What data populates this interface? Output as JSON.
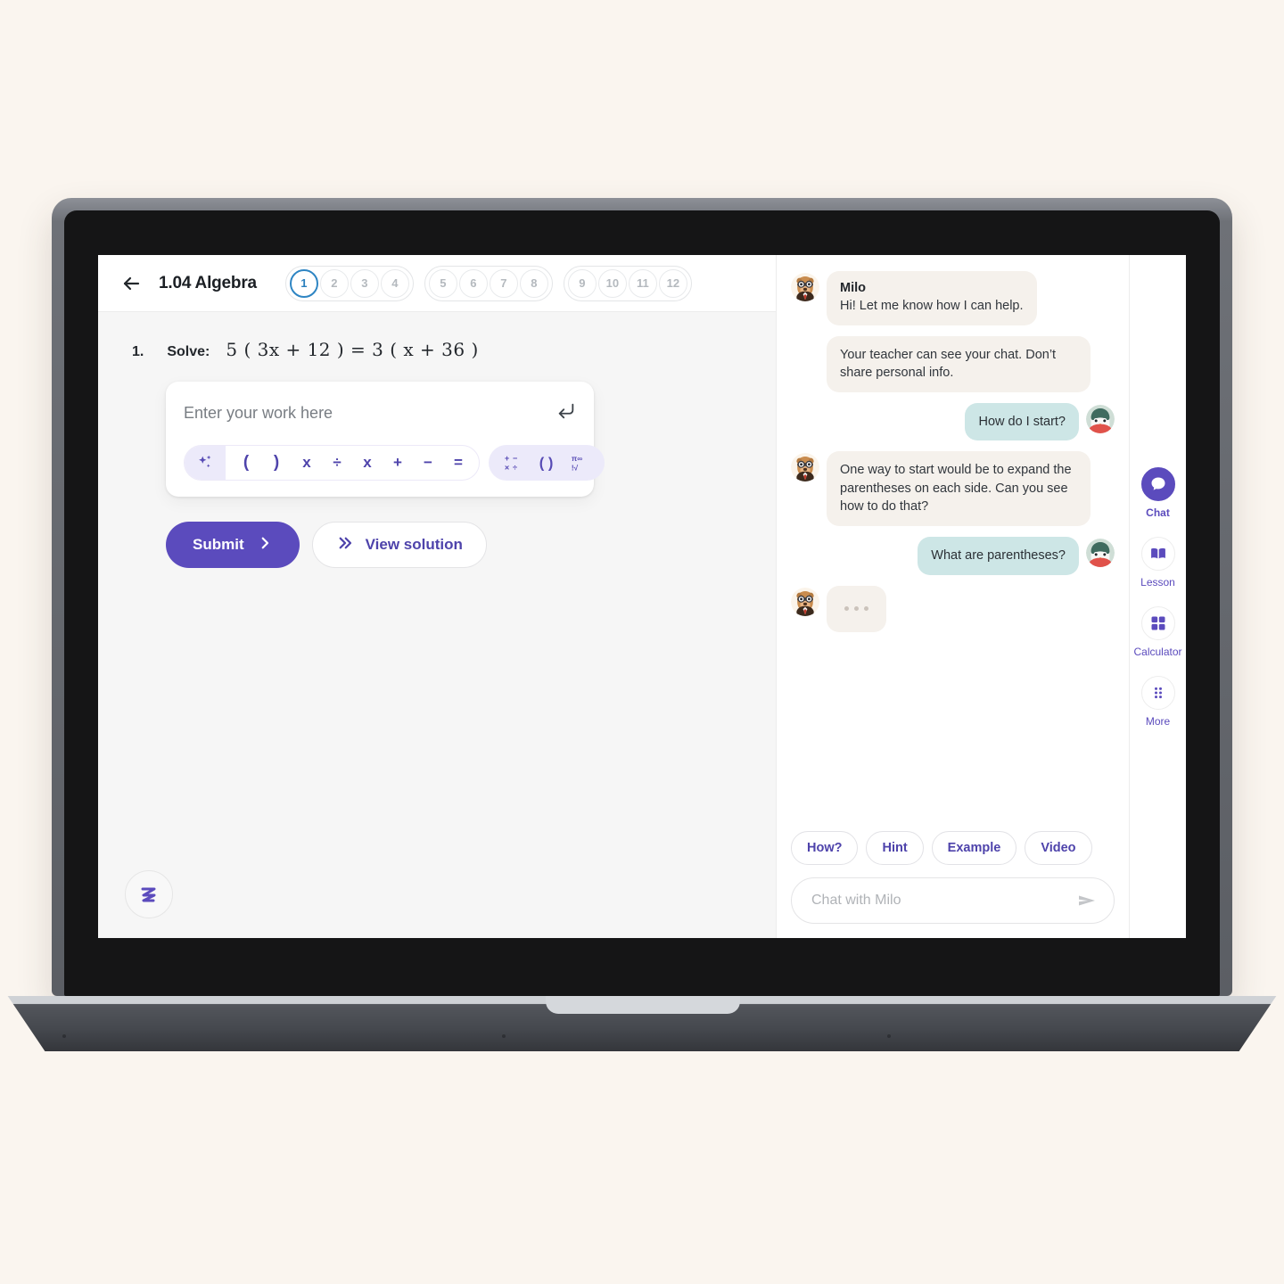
{
  "work": {
    "back_icon": "arrow-left-icon",
    "lesson_title": "1.04 Algebra",
    "pager_groups": [
      [
        "1",
        "2",
        "3",
        "4"
      ],
      [
        "5",
        "6",
        "7",
        "8"
      ],
      [
        "9",
        "10",
        "11",
        "12"
      ]
    ],
    "active_page": "1",
    "question": {
      "number": "1.",
      "prompt": "Solve:",
      "equation": "5 ( 3x + 12 ) = 3 ( x + 36 )"
    },
    "answer_input": {
      "placeholder": "Enter your work here",
      "value": "",
      "enter_icon": "enter-key-icon"
    },
    "math_toolbar": {
      "ai_icon": "sparkles-icon",
      "operators": [
        "(",
        ")",
        "x",
        "÷",
        "x",
        "+",
        "−",
        "="
      ],
      "groups": [
        "basic-operations-icon",
        "parentheses-icon",
        "advanced-symbols-icon"
      ]
    },
    "submit_label": "Submit",
    "view_solution_label": "View solution",
    "brand_logo": "squiggle-logo-icon"
  },
  "chat": {
    "messages": [
      {
        "type": "bot",
        "name": "Milo",
        "text": "Hi! Let me know how I can help.",
        "avatar": "milo-avatar"
      },
      {
        "type": "notice",
        "text": "Your teacher can see your chat. Don’t share personal info."
      },
      {
        "type": "user",
        "text": "How do I start?",
        "avatar": "student-avatar"
      },
      {
        "type": "bot",
        "text": "One way to start would be to expand the parentheses on each side. Can you see how to do that?",
        "avatar": "milo-avatar"
      },
      {
        "type": "user",
        "text": "What are parentheses?",
        "avatar": "student-avatar"
      },
      {
        "type": "typing",
        "avatar": "milo-avatar"
      }
    ],
    "quick_chips": [
      "How?",
      "Hint",
      "Example",
      "Video"
    ],
    "input_placeholder": "Chat with Milo",
    "input_value": "",
    "send_icon": "send-icon"
  },
  "rail": {
    "items": [
      {
        "label": "Chat",
        "icon": "chat-bubble-icon",
        "active": true
      },
      {
        "label": "Lesson",
        "icon": "book-icon",
        "active": false
      },
      {
        "label": "Calculator",
        "icon": "calculator-grid-icon",
        "active": false
      },
      {
        "label": "More",
        "icon": "more-dots-icon",
        "active": false
      }
    ]
  },
  "colors": {
    "brand_purple": "#5b4bbd",
    "accent_blue": "#2a7fbd",
    "user_bubble": "#cde6e6",
    "bot_bubble": "#f5f1ec",
    "page_background": "#faf5ef"
  }
}
